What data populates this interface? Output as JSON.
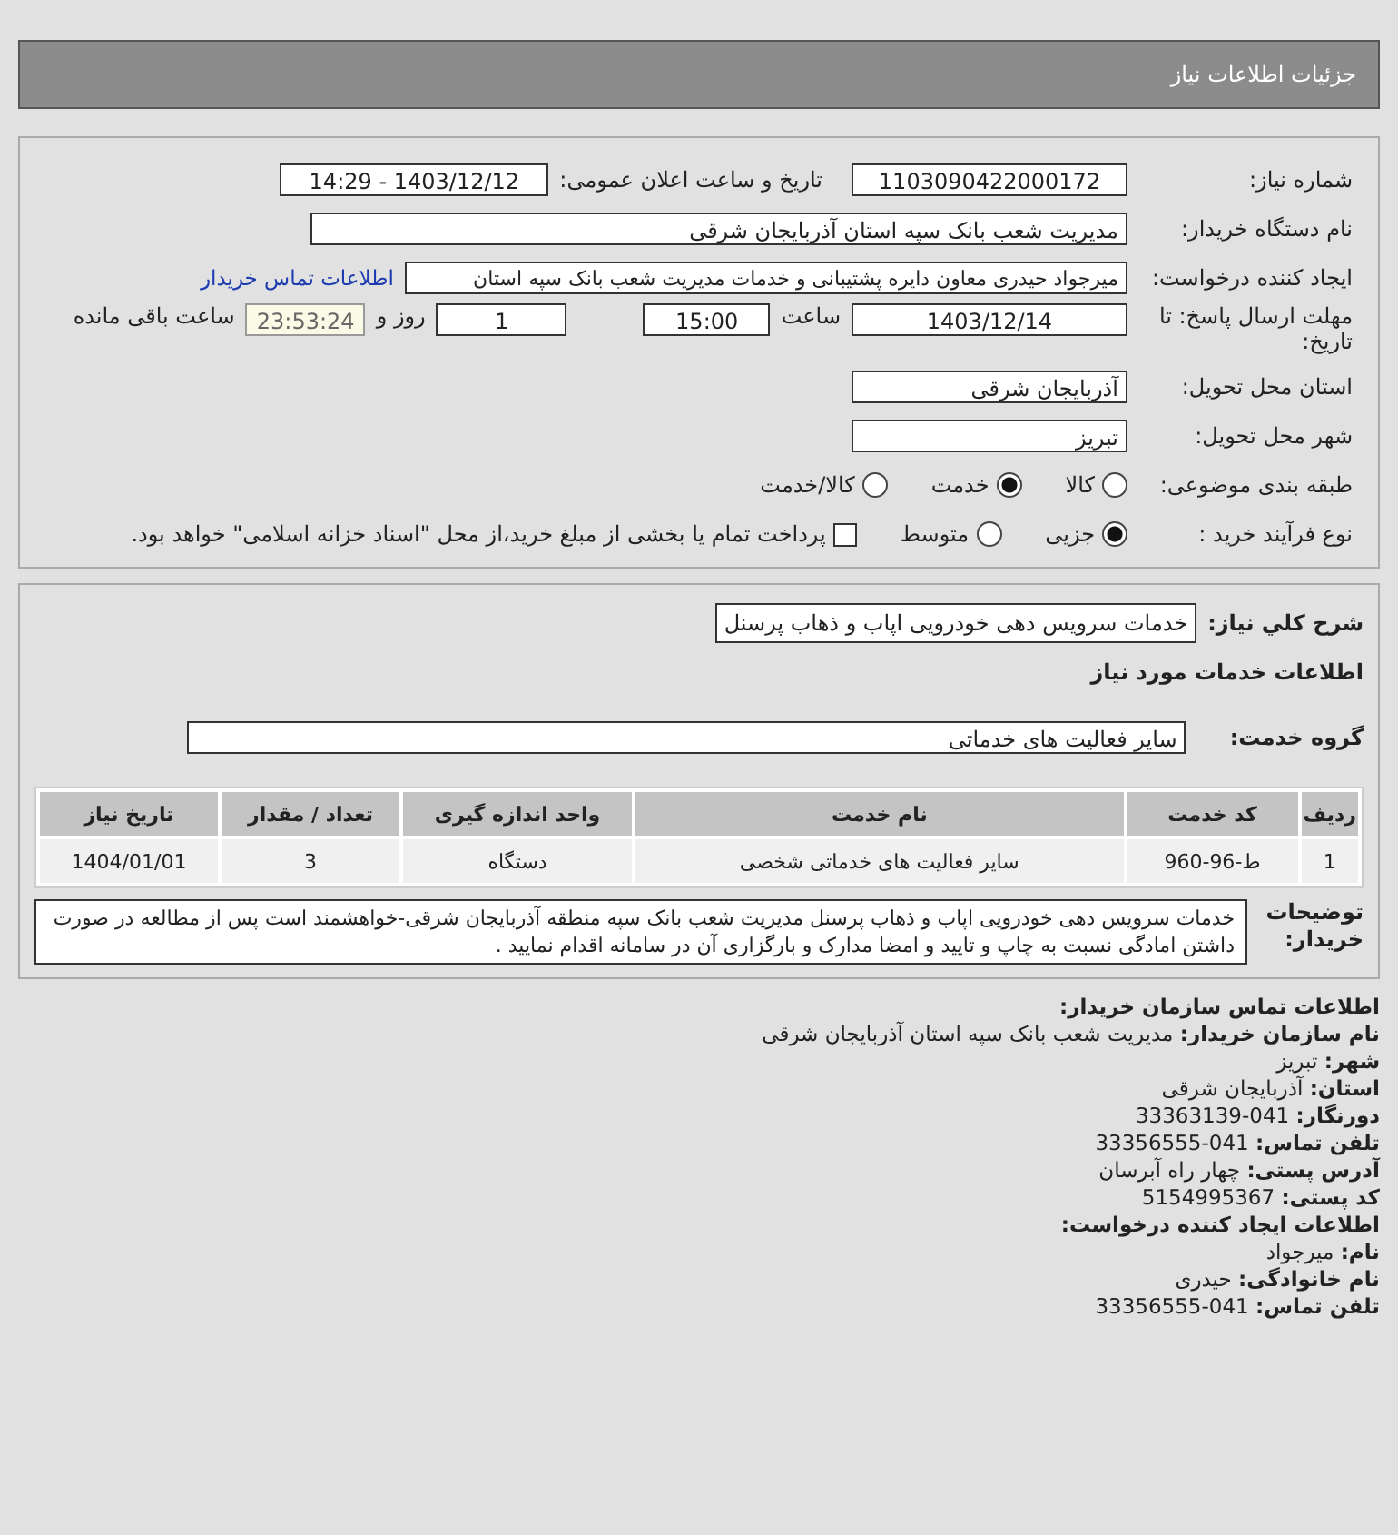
{
  "header": {
    "title": "جزئیات اطلاعات نیاز"
  },
  "details": {
    "need_number": {
      "label": "شماره نیاز:",
      "value": "1103090422000172"
    },
    "announce": {
      "label": "تاریخ و ساعت اعلان عمومی:",
      "value": "1403/12/12 - 14:29"
    },
    "buyer": {
      "label": "نام دستگاه خریدار:",
      "value": "مدیریت شعب بانک سپه استان آذربایجان شرقی"
    },
    "creator": {
      "label": "ایجاد کننده درخواست:",
      "value": "میرجواد حیدری معاون دایره پشتیبانی و خدمات مدیریت شعب بانک سپه استان",
      "link": "اطلاعات تماس خریدار"
    },
    "deadline": {
      "label": "مهلت ارسال پاسخ: تا تاریخ:",
      "date": "1403/12/14",
      "time_label": "ساعت",
      "time": "15:00",
      "days": "1",
      "days_label": "روز و",
      "remaining": "23:53:24",
      "remaining_label": "ساعت باقی مانده"
    },
    "province": {
      "label": "استان محل تحویل:",
      "value": "آذربایجان شرقی"
    },
    "city": {
      "label": "شهر محل تحویل:",
      "value": "تبریز"
    },
    "category": {
      "label": "طبقه بندی موضوعی:",
      "options": [
        {
          "label": "کالا",
          "selected": false
        },
        {
          "label": "خدمت",
          "selected": true
        },
        {
          "label": "کالا/خدمت",
          "selected": false
        }
      ]
    },
    "process": {
      "label": "نوع فرآیند خرید :",
      "options": [
        {
          "label": "جزیی",
          "selected": true
        },
        {
          "label": "متوسط",
          "selected": false
        }
      ],
      "treasury": {
        "checked": false,
        "label": "پرداخت تمام یا بخشی از مبلغ خرید،از محل \"اسناد خزانه اسلامی\" خواهد بود."
      }
    }
  },
  "services": {
    "summary": {
      "label": "شرح کلي نیاز:",
      "value": "خدمات سرویس دهی خودرویی اپاب و ذهاب پرسنل"
    },
    "heading": "اطلاعات خدمات مورد نیاز",
    "group": {
      "label": "گروه خدمت:",
      "value": "سایر فعالیت های خدماتی"
    },
    "table": {
      "columns": [
        "ردیف",
        "کد خدمت",
        "نام خدمت",
        "واحد اندازه گیری",
        "تعداد / مقدار",
        "تاریخ نیاز"
      ],
      "rows": [
        [
          "1",
          "ط-96-960",
          "سایر فعالیت های خدماتی شخصی",
          "دستگاه",
          "3",
          "1404/01/01"
        ]
      ]
    },
    "notes": {
      "label": "توضیحات خریدار:",
      "value": "خدمات سرویس دهی خودرویی اپاب و ذهاب پرسنل مدیریت شعب بانک سپه منطقه آذربایجان شرقی-خواهشمند است پس از مطالعه در صورت داشتن امادگی نسبت به چاپ و تایید و امضا مدارک و بارگزاری آن در سامانه اقدام نمایید ."
    }
  },
  "contact": {
    "title": "اطلاعات تماس سازمان خریدار:",
    "lines": [
      {
        "label": "نام سازمان خریدار:",
        "value": "مدیریت شعب بانک سپه استان آذربایجان شرقی"
      },
      {
        "label": "شهر:",
        "value": "تبریز"
      },
      {
        "label": "استان:",
        "value": "آذربایجان شرقی"
      },
      {
        "label": "دورنگار:",
        "value": "041-33363139"
      },
      {
        "label": "تلفن تماس:",
        "value": "041-33356555"
      },
      {
        "label": "آدرس پستی:",
        "value": "چهار راه آبرسان"
      },
      {
        "label": "کد پستی:",
        "value": "5154995367"
      }
    ],
    "creator_title": "اطلاعات ایجاد کننده درخواست:",
    "creator_lines": [
      {
        "label": "نام:",
        "value": "میرجواد"
      },
      {
        "label": "نام خانوادگی:",
        "value": "حیدری"
      },
      {
        "label": "تلفن تماس:",
        "value": "041-33356555"
      }
    ]
  }
}
